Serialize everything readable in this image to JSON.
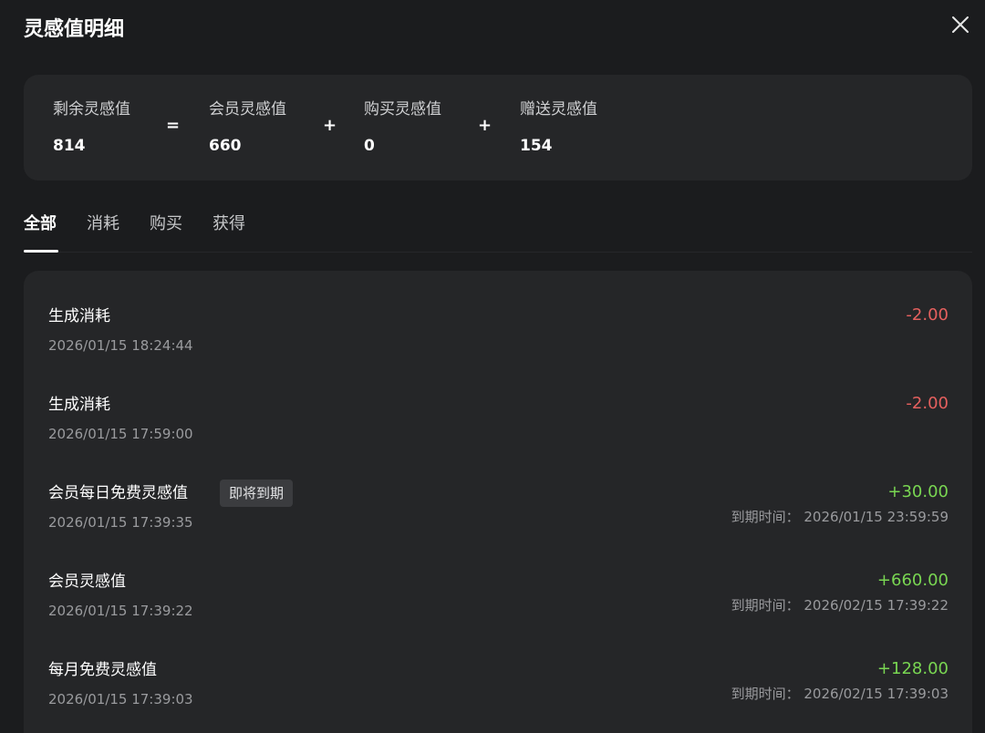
{
  "dialog": {
    "title": "灵感值明细"
  },
  "summary": {
    "remaining": {
      "label": "剩余灵感值",
      "value": "814"
    },
    "equals": "=",
    "member": {
      "label": "会员灵感值",
      "value": "660"
    },
    "plus1": "+",
    "purchased": {
      "label": "购买灵感值",
      "value": "0"
    },
    "plus2": "+",
    "gifted": {
      "label": "赠送灵感值",
      "value": "154"
    }
  },
  "tabs": [
    {
      "label": "全部",
      "active": true
    },
    {
      "label": "消耗",
      "active": false
    },
    {
      "label": "购买",
      "active": false
    },
    {
      "label": "获得",
      "active": false
    }
  ],
  "records": [
    {
      "title": "生成消耗",
      "time": "2026/01/15 18:24:44",
      "amount": "-2.00",
      "type": "negative"
    },
    {
      "title": "生成消耗",
      "time": "2026/01/15 17:59:00",
      "amount": "-2.00",
      "type": "negative"
    },
    {
      "title": "会员每日免费灵感值",
      "badge": "即将到期",
      "time": "2026/01/15 17:39:35",
      "amount": "+30.00",
      "type": "positive",
      "expire": "到期时间： 2026/01/15 23:59:59"
    },
    {
      "title": "会员灵感值",
      "time": "2026/01/15 17:39:22",
      "amount": "+660.00",
      "type": "positive",
      "expire": "到期时间： 2026/02/15 17:39:22"
    },
    {
      "title": "每月免费灵感值",
      "time": "2026/01/15 17:39:03",
      "amount": "+128.00",
      "type": "positive",
      "expire": "到期时间： 2026/02/15 17:39:03"
    }
  ],
  "colors": {
    "background": "#1b1c1e",
    "card": "#252628",
    "negative": "#e5605e",
    "positive": "#79d652"
  },
  "icons": {
    "close": "close-icon"
  }
}
